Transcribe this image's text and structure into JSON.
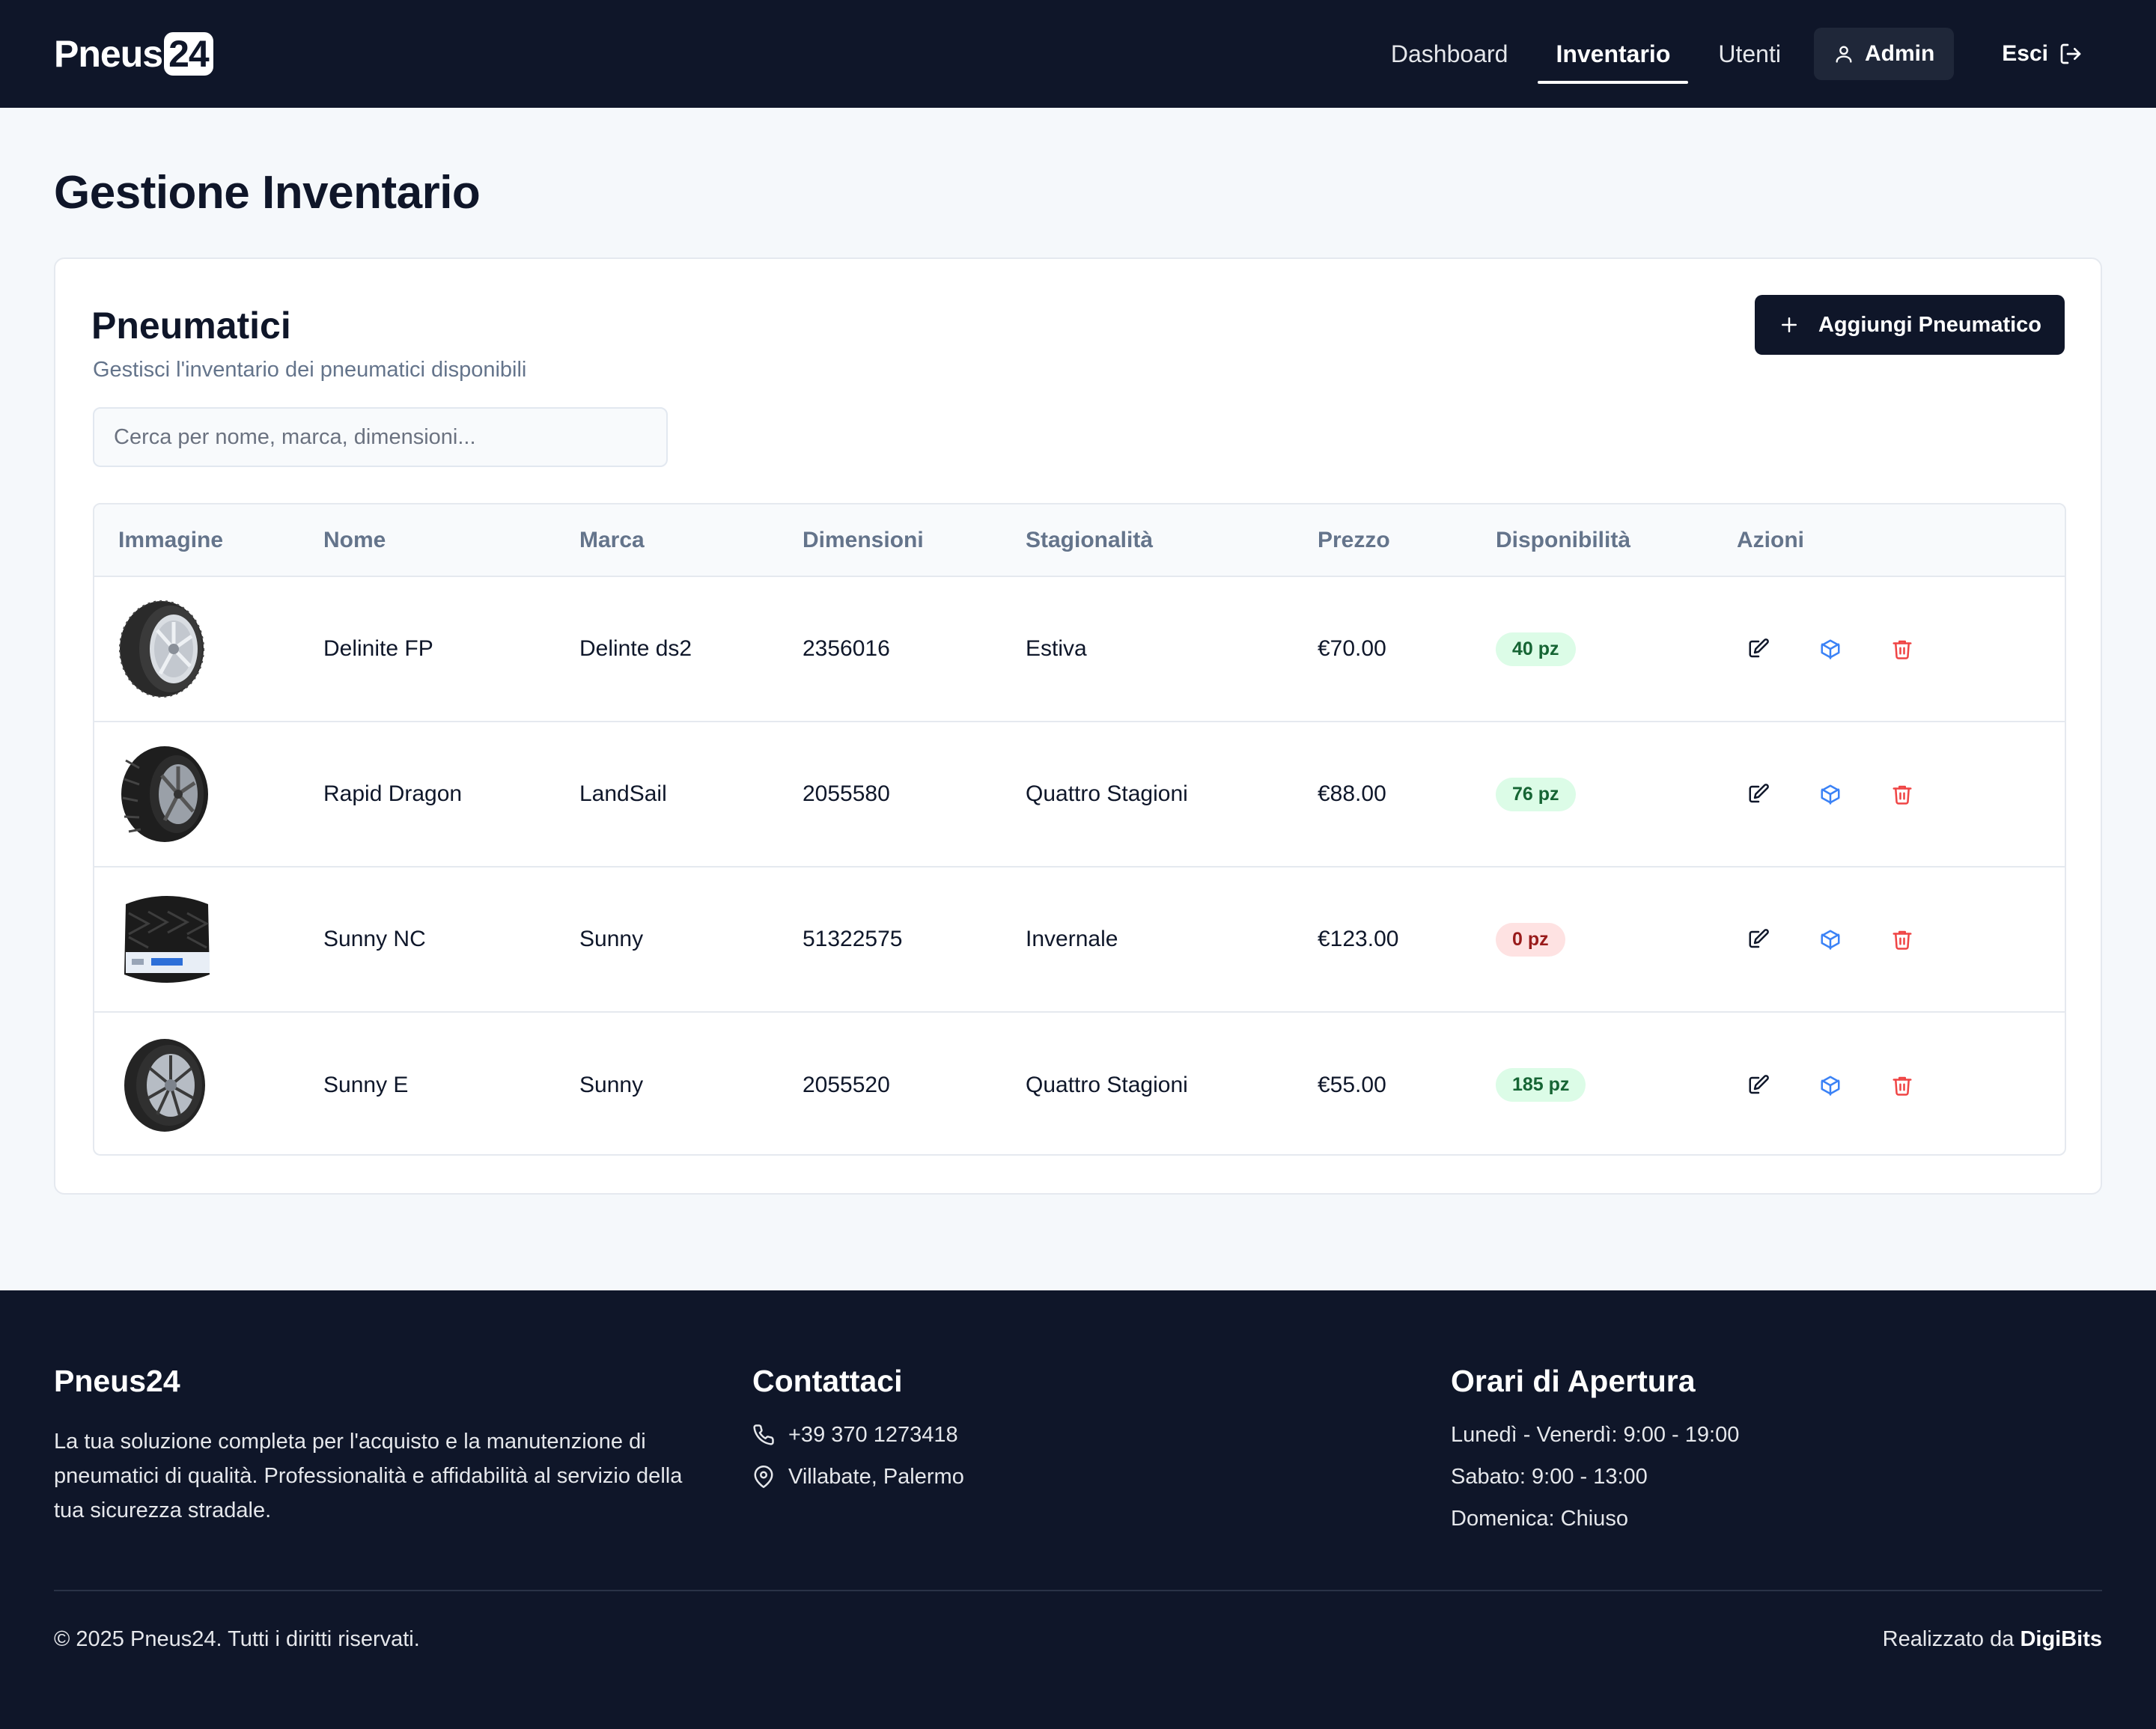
{
  "brand": {
    "name": "Pneus",
    "num": "24"
  },
  "nav": {
    "items": [
      {
        "label": "Dashboard",
        "active": false
      },
      {
        "label": "Inventario",
        "active": true
      },
      {
        "label": "Utenti",
        "active": false
      }
    ],
    "admin_label": "Admin",
    "logout_label": "Esci"
  },
  "page": {
    "title": "Gestione Inventario"
  },
  "card": {
    "title": "Pneumatici",
    "subtitle": "Gestisci l'inventario dei pneumatici disponibili",
    "add_label": "Aggiungi Pneumatico",
    "search_placeholder": "Cerca per nome, marca, dimensioni..."
  },
  "table": {
    "headers": [
      "Immagine",
      "Nome",
      "Marca",
      "Dimensioni",
      "Stagionalità",
      "Prezzo",
      "Disponibilità",
      "Azioni"
    ],
    "rows": [
      {
        "name": "Delinite FP",
        "brand": "Delinte ds2",
        "size": "2356016",
        "season": "Estiva",
        "price": "€70.00",
        "stock": "40 pz",
        "in_stock": true,
        "image": "tire-alloy-silver"
      },
      {
        "name": "Rapid Dragon",
        "brand": "LandSail",
        "size": "2055580",
        "season": "Quattro Stagioni",
        "price": "€88.00",
        "stock": "76 pz",
        "in_stock": true,
        "image": "tire-alloy-dark"
      },
      {
        "name": "Sunny NC",
        "brand": "Sunny",
        "size": "51322575",
        "season": "Invernale",
        "price": "€123.00",
        "stock": "0 pz",
        "in_stock": false,
        "image": "tire-tread-label"
      },
      {
        "name": "Sunny E",
        "brand": "Sunny",
        "size": "2055520",
        "season": "Quattro Stagioni",
        "price": "€55.00",
        "stock": "185 pz",
        "in_stock": true,
        "image": "tire-alloy-spoke"
      }
    ]
  },
  "footer": {
    "about": {
      "title": "Pneus24",
      "text": "La tua soluzione completa per l'acquisto e la manutenzione di pneumatici di qualità. Professionalità e affidabilità al servizio della tua sicurezza stradale."
    },
    "contact": {
      "title": "Contattaci",
      "phone": "+39 370 1273418",
      "address": "Villabate, Palermo"
    },
    "hours": {
      "title": "Orari di Apertura",
      "weekdays": "Lunedì - Venerdì: 9:00 - 19:00",
      "saturday": "Sabato: 9:00 - 13:00",
      "sunday": "Domenica: Chiuso"
    },
    "copyright": "© 2025 Pneus24. Tutti i diritti riservati.",
    "made_by_prefix": "Realizzato da",
    "made_by_name": "DigiBits"
  },
  "colors": {
    "navy": "#0f1629",
    "stock_ok_bg": "#dcfce7",
    "stock_out_bg": "#fee2e2",
    "edit": "#0f172a",
    "inventory_action": "#3b82f6",
    "delete": "#ef4444"
  }
}
